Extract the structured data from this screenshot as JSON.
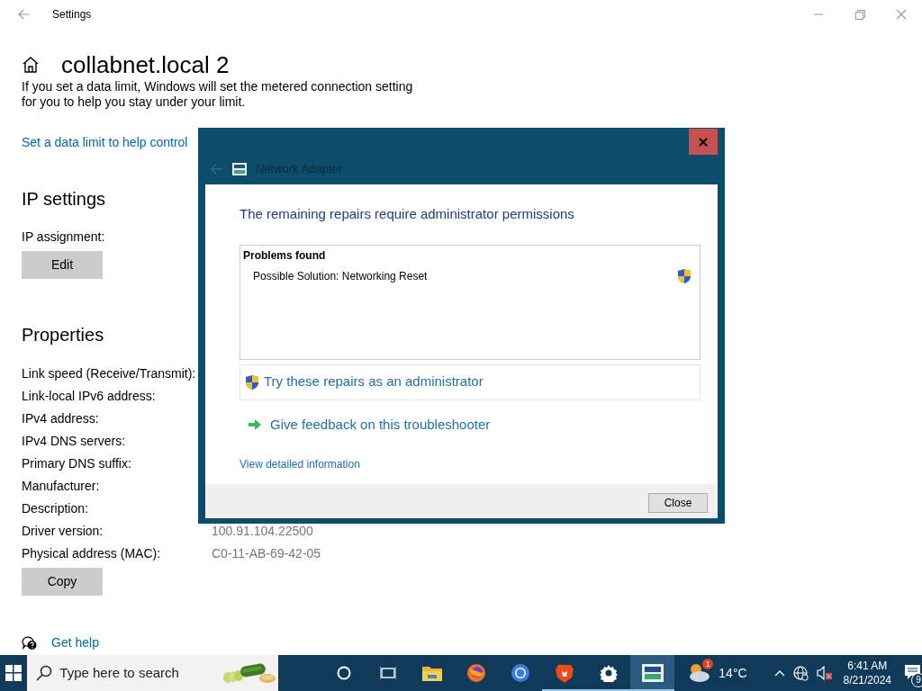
{
  "window": {
    "title": "Settings"
  },
  "page": {
    "title": "collabnet.local 2",
    "note": "If you set a data limit, Windows will set the metered connection setting for you to help you stay under your limit.",
    "link": "Set a data limit to help control"
  },
  "ip_settings": {
    "heading": "IP settings",
    "label": "IP assignment:",
    "button": "Edit"
  },
  "properties": {
    "heading": "Properties",
    "rows": [
      {
        "label": "Link speed (Receive/Transmit):"
      },
      {
        "label": "Link-local IPv6 address:"
      },
      {
        "label": "IPv4 address:"
      },
      {
        "label": "IPv4 DNS servers:"
      },
      {
        "label": "Primary DNS suffix:"
      },
      {
        "label": "Manufacturer:"
      },
      {
        "label": "Description:"
      },
      {
        "label": "Driver version:",
        "value": "100.91.104.22500"
      },
      {
        "label": "Physical address (MAC):",
        "value": "C0-11-AB-69-42-05"
      }
    ],
    "button": "Copy"
  },
  "help_link": "Get help",
  "dialog": {
    "title": "Network Adapter",
    "heading": "The remaining repairs require administrator permissions",
    "problems_header": "Problems found",
    "problems": [
      {
        "text": "Possible Solution: Networking Reset"
      }
    ],
    "actions": [
      {
        "kind": "admin",
        "label": "Try these repairs as an administrator"
      },
      {
        "kind": "feedback",
        "label": "Give feedback on this troubleshooter"
      }
    ],
    "details_link": "View detailed information",
    "close_button": "Close"
  },
  "taskbar": {
    "search_placeholder": "Type here to search",
    "apps": [
      {
        "kind": "cortana",
        "running": false,
        "selected": false
      },
      {
        "kind": "taskview",
        "running": false,
        "selected": false
      },
      {
        "kind": "explorer",
        "running": false,
        "selected": false
      },
      {
        "kind": "firefox",
        "running": false,
        "selected": false
      },
      {
        "kind": "chrome",
        "running": false,
        "selected": false
      },
      {
        "kind": "brave",
        "running": true,
        "selected": false
      },
      {
        "kind": "settings",
        "running": true,
        "selected": false
      },
      {
        "kind": "troubleshooter",
        "running": true,
        "selected": true
      }
    ],
    "weather": {
      "temperature": "14°C",
      "badge": "1"
    },
    "time": "6:41 AM",
    "date": "8/21/2024",
    "notifications": "9"
  }
}
